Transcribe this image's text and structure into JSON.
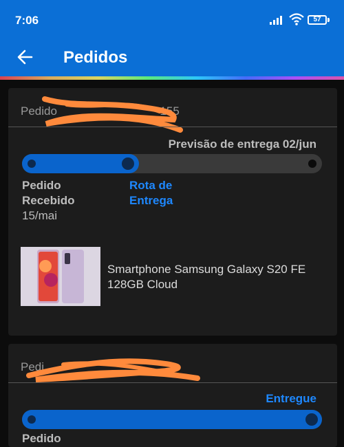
{
  "status_bar": {
    "time": "7:06",
    "battery": "57"
  },
  "header": {
    "title": "Pedidos"
  },
  "orders": [
    {
      "order_label": "Pedido",
      "order_suffix": "155",
      "delivery_forecast": "Previsão de entrega 02/jun",
      "progress": 0.36,
      "steps": [
        {
          "label": "Pedido\nRecebido",
          "date": "15/mai"
        },
        {
          "label": "Rota de\nEntrega"
        }
      ],
      "product_name": "Smartphone Samsung Galaxy S20 FE 128GB Cloud"
    },
    {
      "order_label": "Pedi",
      "status": "Entregue",
      "progress": 1.0,
      "steps": [
        {
          "label": "Pedido"
        }
      ]
    }
  ]
}
